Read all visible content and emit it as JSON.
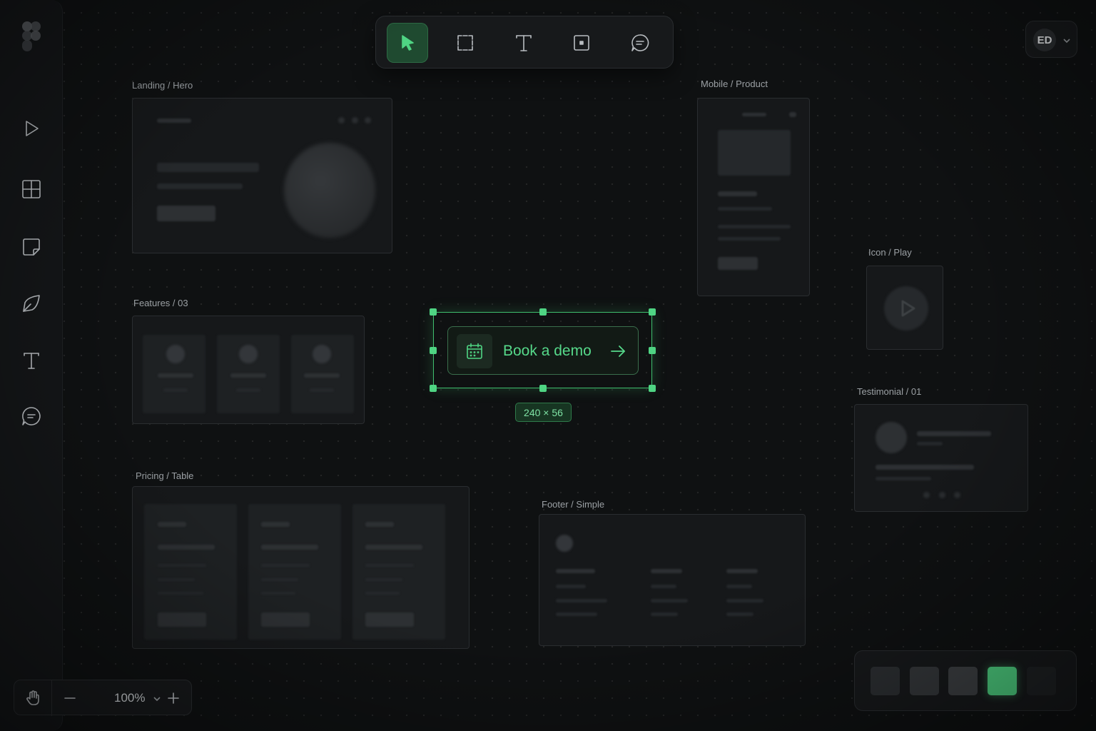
{
  "sidebar": {
    "items": [
      {
        "name": "play",
        "icon": "play-icon"
      },
      {
        "name": "grid",
        "icon": "grid-icon"
      },
      {
        "name": "sticky",
        "icon": "sticky-note-icon"
      },
      {
        "name": "pen",
        "icon": "pen-nib-icon"
      },
      {
        "name": "text",
        "icon": "text-icon"
      },
      {
        "name": "comment",
        "icon": "comment-icon"
      }
    ]
  },
  "toolbar": {
    "tools": [
      {
        "name": "select",
        "icon": "cursor-icon",
        "active": true
      },
      {
        "name": "frame",
        "icon": "frame-icon",
        "active": false
      },
      {
        "name": "text",
        "icon": "text-icon",
        "active": false
      },
      {
        "name": "component",
        "icon": "component-icon",
        "active": false
      },
      {
        "name": "comment",
        "icon": "comment-icon",
        "active": false
      }
    ]
  },
  "user": {
    "initials": "ED"
  },
  "frames": {
    "landing": "Landing / Hero",
    "features": "Features / 03",
    "pricing": "Pricing / Table",
    "mobile": "Mobile / Product",
    "icon_play": "Icon / Play",
    "testimonial": "Testimonial / 01",
    "footer": "Footer / Simple"
  },
  "selection": {
    "button_label": "Book a demo",
    "size": "240 × 56",
    "accent": "#4fd483"
  },
  "zoom": {
    "level": "100%"
  },
  "palette": {
    "swatches": [
      "#2c2f32",
      "#35383b",
      "#3d4043",
      "#4fd483",
      "#1f2224"
    ],
    "selected_index": 3
  }
}
